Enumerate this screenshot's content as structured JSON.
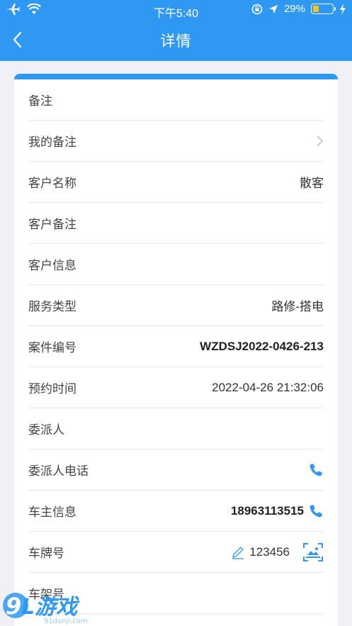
{
  "status_bar": {
    "time": "下午5:40",
    "battery_text": "29%",
    "battery_level": 0.29,
    "icons": [
      "airplane-icon",
      "wifi-icon",
      "lock-rotation-icon",
      "location-icon",
      "battery-icon",
      "charging-icon"
    ]
  },
  "nav": {
    "title": "详情",
    "back_icon": "chevron-left-icon"
  },
  "colors": {
    "accent": "#2f98f2",
    "battery": "#f5c518"
  },
  "rows": [
    {
      "label": "备注",
      "value": ""
    },
    {
      "label": "我的备注",
      "value": "",
      "chevron": true
    },
    {
      "label": "客户名称",
      "value": "散客"
    },
    {
      "label": "客户备注",
      "value": ""
    },
    {
      "label": "客户信息",
      "value": ""
    },
    {
      "label": "服务类型",
      "value": "路修-搭电"
    },
    {
      "label": "案件编号",
      "value": "WZDSJ2022-0426-213"
    },
    {
      "label": "预约时间",
      "value": "2022-04-26 21:32:06"
    },
    {
      "label": "委派人",
      "value": ""
    },
    {
      "label": "委派人电话",
      "value": ""
    },
    {
      "label": "车主信息",
      "value": "18963113515"
    },
    {
      "label": "车牌号",
      "value": "123456"
    },
    {
      "label": "车架号",
      "value": ""
    }
  ],
  "watermark": {
    "logo": "9L游戏",
    "url": "91danji.com"
  }
}
